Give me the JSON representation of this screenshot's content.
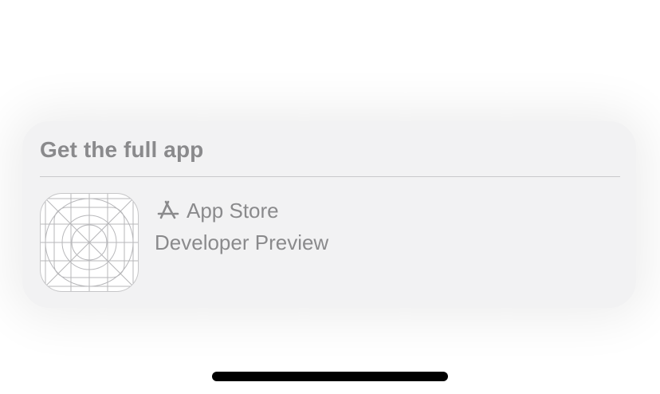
{
  "sheet": {
    "title": "Get the full app",
    "app": {
      "icon": "app-icon-grid-placeholder",
      "store_icon": "app-store-icon",
      "store_label": "App Store",
      "subtitle": "Developer Preview"
    }
  },
  "colors": {
    "card_background": "#f2f2f3",
    "text_secondary": "#8a8a8c",
    "divider": "#c9c9cb",
    "home_indicator": "#000000"
  }
}
